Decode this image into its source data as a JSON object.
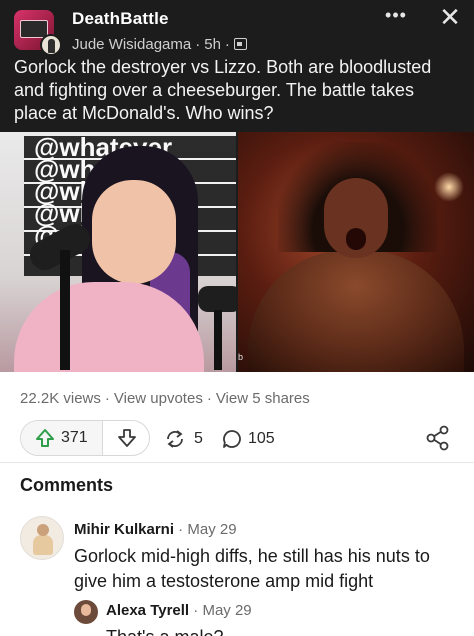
{
  "post": {
    "group_name": "DeathBattle",
    "author": "Jude Wisidagama",
    "time": "5h",
    "more_label": "•••",
    "close_label": "✕",
    "text": "Gorlock the destroyer vs Lizzo. Both are bloodlusted and fighting over a cheeseburger. The battle takes place at McDonald's. Who wins?",
    "image_left": {
      "wall_text": "@whatever\n@whatever\n@whatever\n@whatever\n@whatever"
    },
    "image_right": {
      "corner_mark": "b"
    }
  },
  "stats": {
    "views": "22.2K views",
    "upvotes_link": "View upvotes",
    "shares_link": "View 5 shares",
    "separator": "·"
  },
  "actions": {
    "upvote_count": "371",
    "share_count": "5",
    "comment_count": "105"
  },
  "comments": {
    "title": "Comments",
    "items": [
      {
        "author": "Mihir Kulkarni",
        "date": "May 29",
        "text": "Gorlock mid-high diffs, he still has his nuts to give him a testosterone amp mid fight"
      },
      {
        "author": "Alexa Tyrell",
        "date": "May 29",
        "text": "That's a male?"
      }
    ]
  },
  "colors": {
    "post_bg": "#1c1c1c",
    "page_bg": "#ffffff",
    "muted_text": "#6b6b6b"
  },
  "icons": [
    "group-avatar",
    "user-avatar",
    "more-icon",
    "close-icon",
    "calendar-icon",
    "upvote-icon",
    "downvote-icon",
    "share-icon",
    "comment-icon",
    "share-out-icon"
  ]
}
